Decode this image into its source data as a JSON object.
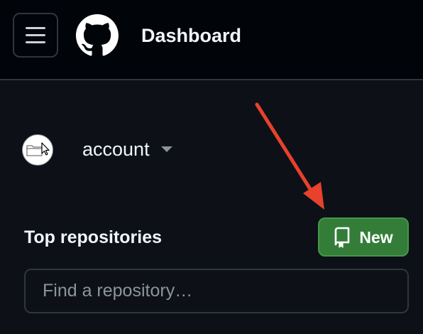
{
  "header": {
    "title": "Dashboard",
    "menu_icon": "hamburger-menu-icon",
    "logo_icon": "github-logo-icon"
  },
  "account": {
    "name": "account",
    "avatar_icon": "folder-cursor-icon",
    "caret_icon": "caret-down-icon"
  },
  "repositories": {
    "title": "Top repositories",
    "new_button_label": "New",
    "new_button_icon": "repo-icon",
    "search_placeholder": "Find a repository…"
  },
  "annotation": {
    "arrow_icon": "red-arrow-icon",
    "arrow_color": "#e8412c"
  },
  "colors": {
    "header_bg": "#010409",
    "page_bg": "#0d1117",
    "border": "#30363d",
    "button_green": "#347d39",
    "text": "#f0f6fc"
  }
}
